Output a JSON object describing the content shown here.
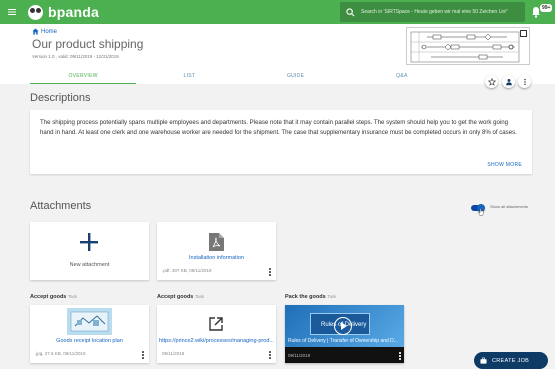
{
  "app": {
    "name": "bpanda"
  },
  "search": {
    "placeholder": "Search in 'SIRTSpace - Heute geben wir mal eine 50 Zeichen Lin!'"
  },
  "notifications": {
    "count": "99+"
  },
  "breadcrumb": {
    "home": "Home"
  },
  "page": {
    "title": "Our product shipping",
    "version": "Version 1.0 , valid: 09/11/2019 - 12/31/2019"
  },
  "tabs": [
    {
      "label": "OVERVIEW",
      "active": true
    },
    {
      "label": "LIST",
      "active": false
    },
    {
      "label": "GUIDE",
      "active": false
    },
    {
      "label": "Q&A",
      "active": false
    }
  ],
  "descriptions": {
    "title": "Descriptions",
    "text": "The shipping process potentially spans multiple employees and departments. Please note that it may contain parallel steps. The system should help you to get the work going hand in hand. At least one clerk and one warehouse worker are needed for the shipment. The case that supplementary insurance must be completed occurs in only 8% of cases.",
    "show_more": "SHOW MORE"
  },
  "attachments": {
    "title": "Attachments",
    "show_all_label": "Show all attachments",
    "show_all": true,
    "new_attachment": "New attachment",
    "installation": {
      "title": "Installation information",
      "meta": ".pdf, 307 KB, 09/11/2019"
    }
  },
  "groups": [
    {
      "name": "Accept goods",
      "tag": "Task"
    },
    {
      "name": "Accept goods",
      "tag": "Task"
    },
    {
      "name": "Pack the goods",
      "tag": "Task"
    }
  ],
  "tasks": {
    "receipt": {
      "title": "Goods receipt location plan",
      "meta": ".jpg, 27.6 KB, 09/11/2019"
    },
    "link": {
      "title": "https://prince2.wiki/processes/managing-prod...",
      "meta": "09/11/2019"
    },
    "video": {
      "title": "Rules of Delivery | Transfer of Ownership and D...",
      "meta": "09/11/2019",
      "slide_text": "Rules of Delivery"
    }
  },
  "fab": {
    "label": "CREATE JOB"
  },
  "colors": {
    "primary": "#4caf50",
    "link": "#1565c0",
    "fab": "#0d3b66"
  }
}
